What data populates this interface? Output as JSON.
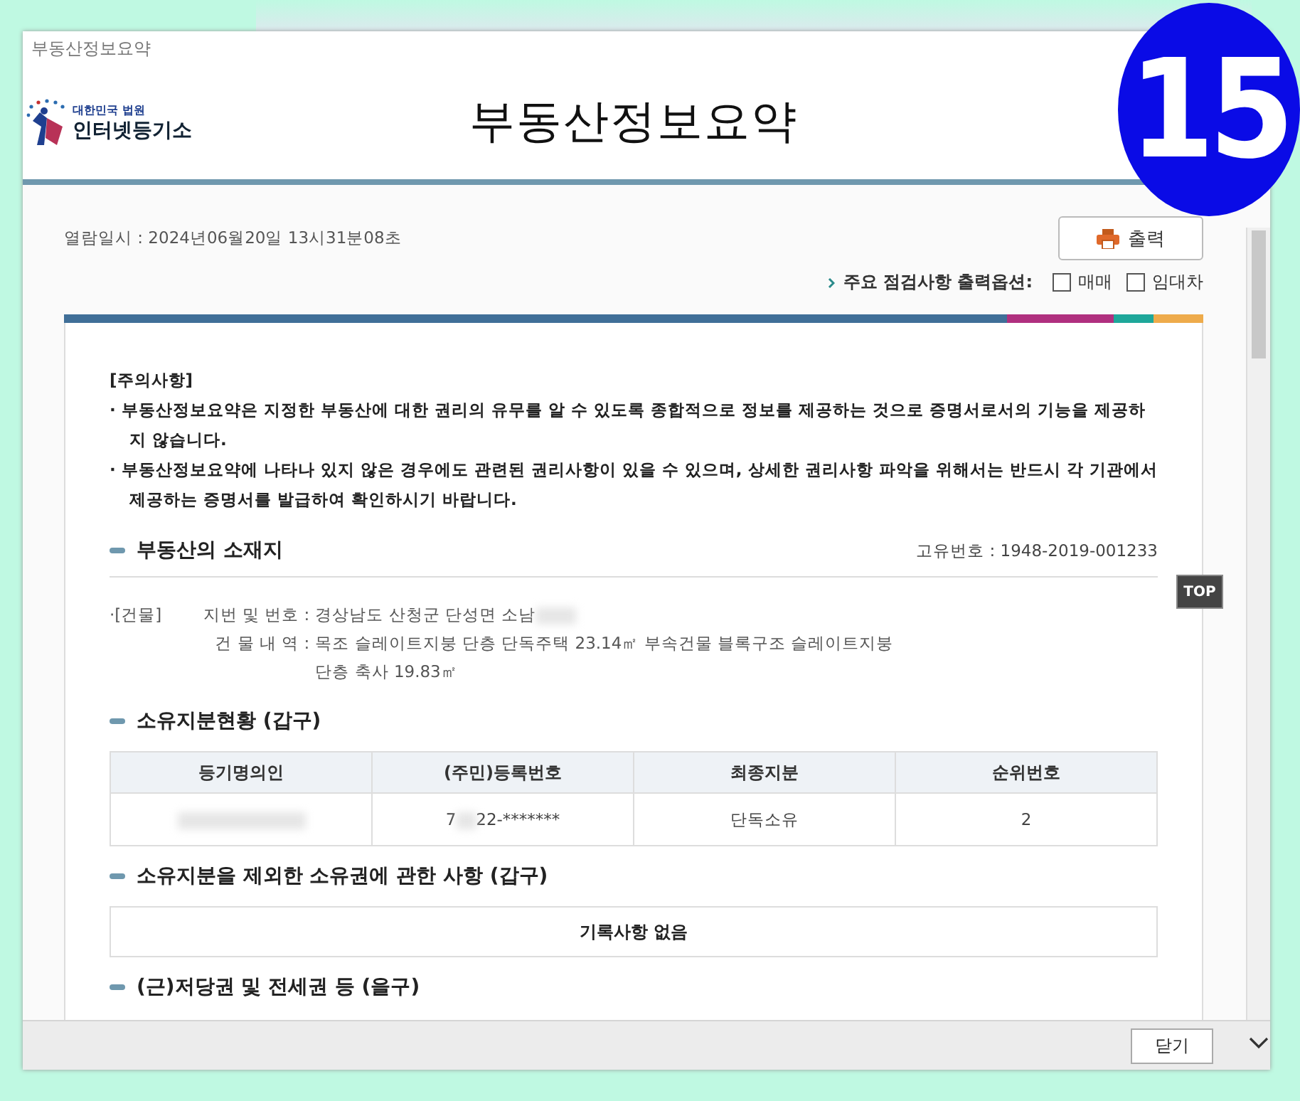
{
  "badge": "15",
  "window": {
    "title": "부동산정보요약"
  },
  "logo": {
    "subtitle": "대한민국 법원",
    "name": "인터넷등기소"
  },
  "page_title": "부동산정보요약",
  "viewed_at": "열람일시 : 2024년06월20일 13시31분08초",
  "print_button": "출력",
  "print_options": {
    "label": "주요 점검사항 출력옵션:",
    "options": [
      {
        "label": "매매",
        "checked": false
      },
      {
        "label": "임대차",
        "checked": false
      }
    ]
  },
  "notice": {
    "heading": "[주의사항]",
    "items": [
      "· 부동산정보요약은 지정한 부동산에 대한 권리의 유무를 알 수 있도록 종합적으로 정보를 제공하는 것으로 증명서로서의 기능을 제공하지 않습니다.",
      "· 부동산정보요약에 나타나 있지 않은 경우에도 관련된 권리사항이 있을 수 있으며, 상세한 권리사항 파악을 위해서는 반드시 각 기관에서 제공하는 증명서를 발급하여 확인하시기 바랍니다."
    ]
  },
  "location": {
    "title": "부동산의 소재지",
    "unique_no": "고유번호 : 1948-2019-001233",
    "tag": "·[건물]",
    "rows": [
      {
        "label": "지번 및 번호 :",
        "value": "경상남도 산청군 단성면 소남",
        "blurred": true
      },
      {
        "label": "건 물 내 역 :",
        "value": "목조 슬레이트지붕 단층  단독주택   23.14㎡  부속건물  블록구조 슬레이트지붕  단층 축사  19.83㎡",
        "blurred": false
      }
    ]
  },
  "ownership": {
    "title": "소유지분현황 (갑구)",
    "columns": [
      "등기명의인",
      "(주민)등록번호",
      "최종지분",
      "순위번호"
    ],
    "rows": [
      {
        "registration_no_start": "7",
        "registration_no_end": "22-*******",
        "share": "단독소유",
        "rank": "2"
      }
    ]
  },
  "other_ownership": {
    "title": "소유지분을 제외한 소유권에 관한 사항 (갑구)",
    "empty": "기록사항 없음"
  },
  "mortgage": {
    "title": "(근)저당권 및 전세권 등 (을구)"
  },
  "top_button": "TOP",
  "close_button": "닫기"
}
